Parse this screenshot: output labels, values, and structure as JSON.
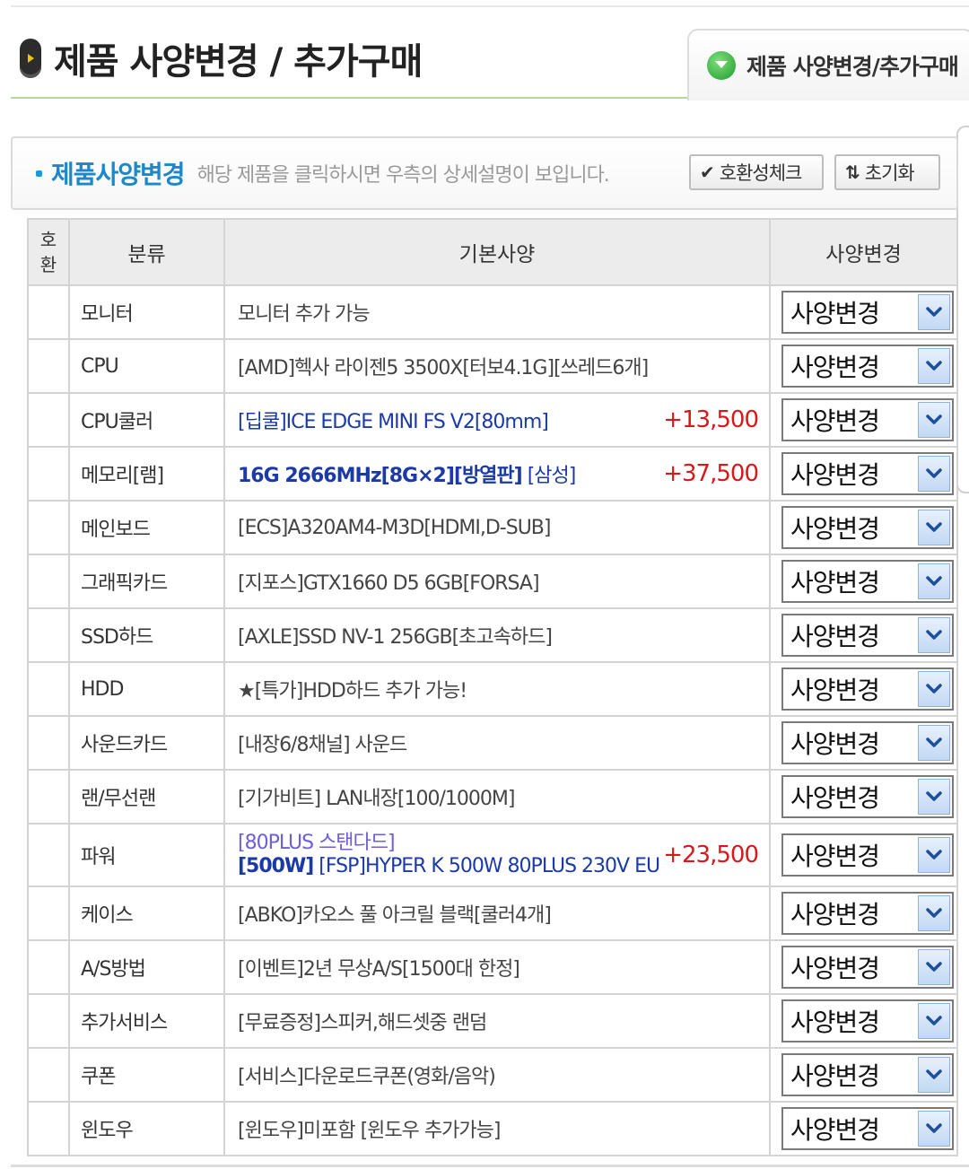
{
  "header": {
    "title": "제품 사양변경 / 추가구매",
    "tab_label": "제품 사양변경/추가구매"
  },
  "section": {
    "title": "제품사양변경",
    "description": "해당 제품을 클릭하시면 우측의 상세설명이 보입니다.",
    "compat_button": "호환성체크",
    "reset_button": "초기화"
  },
  "table": {
    "headers": {
      "compat": "호환",
      "category": "분류",
      "spec": "기본사양",
      "change": "사양변경"
    },
    "select_label": "사양변경",
    "rows": [
      {
        "category": "모니터",
        "spec": "모니터 추가 가능",
        "price": ""
      },
      {
        "category": "CPU",
        "spec": "[AMD]헥사 라이젠5 3500X[터보4.1G][쓰레드6개]",
        "price": ""
      },
      {
        "category": "CPU쿨러",
        "spec": "[딥쿨]ICE EDGE MINI FS V2[80mm]",
        "price": "+13,500"
      },
      {
        "category": "메모리[램]",
        "spec_bold": "16G 2666MHz[8G×2][방열판]",
        "spec": " [삼성]",
        "price": "+37,500"
      },
      {
        "category": "메인보드",
        "spec": "[ECS]A320AM4-M3D[HDMI,D-SUB]",
        "price": ""
      },
      {
        "category": "그래픽카드",
        "spec": "[지포스]GTX1660 D5 6GB[FORSA]",
        "price": ""
      },
      {
        "category": "SSD하드",
        "spec": "[AXLE]SSD NV-1 256GB[초고속하드]",
        "price": ""
      },
      {
        "category": "HDD",
        "spec": "★[특가]HDD하드 추가 가능!",
        "price": ""
      },
      {
        "category": "사운드카드",
        "spec": "[내장6/8채널] 사운드",
        "price": ""
      },
      {
        "category": "랜/무선랜",
        "spec": "[기가비트] LAN내장[100/1000M]",
        "price": ""
      },
      {
        "category": "파워",
        "spec_line1": "[80PLUS 스탠다드]",
        "spec_bold": "[500W]",
        "spec": " [FSP]HYPER K 500W 80PLUS 230V EU",
        "price": "+23,500"
      },
      {
        "category": "케이스",
        "spec": "[ABKO]카오스 풀 아크릴 블랙[쿨러4개]",
        "price": ""
      },
      {
        "category": "A/S방법",
        "spec": "[이벤트]2년 무상A/S[1500대 한정]",
        "price": ""
      },
      {
        "category": "추가서비스",
        "spec": "[무료증정]스피커,해드셋중 랜덤",
        "price": ""
      },
      {
        "category": "쿠폰",
        "spec": "[서비스]다운로드쿠폰(영화/음악)",
        "price": ""
      },
      {
        "category": "윈도우",
        "spec": "[윈도우]미포함 [윈도우 추가가능]",
        "price": ""
      }
    ]
  },
  "colors": {
    "accent_blue": "#1a88c9",
    "price_red": "#d7191c",
    "spec_blue": "#1b3aa8"
  }
}
